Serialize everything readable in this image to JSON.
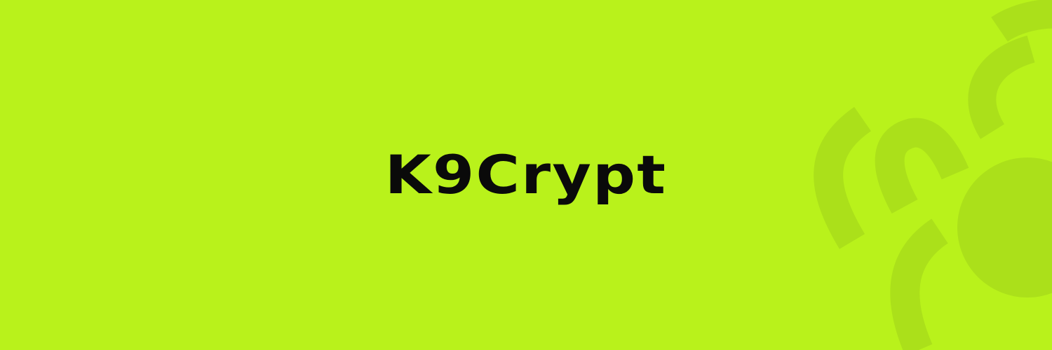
{
  "brand": {
    "name": "K9Crypt"
  },
  "colors": {
    "background": "#b9f21b",
    "text": "#0a0a0a",
    "decoration": "#abe01a"
  },
  "decoration": {
    "icon": "paw-print-icon"
  }
}
